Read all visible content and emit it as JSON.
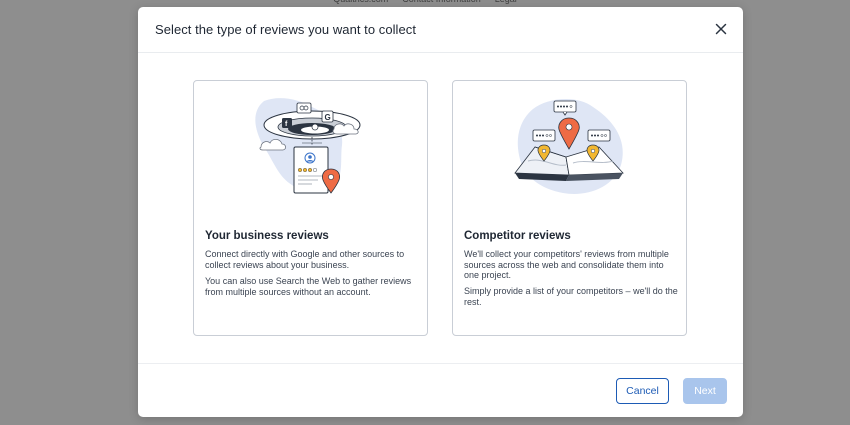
{
  "background": {
    "footer_links": [
      "Qualtrics.com",
      "Contact Information",
      "Legal"
    ]
  },
  "modal": {
    "title": "Select the type of reviews you want to collect",
    "close_icon": "close-icon"
  },
  "cards": [
    {
      "title": "Your business reviews",
      "paragraphs": [
        "Connect directly with Google and other sources to collect reviews about your business.",
        "You can also use Search the Web to gather reviews from multiple sources without an account."
      ],
      "illustration": "business-reviews-illustration"
    },
    {
      "title": "Competitor reviews",
      "paragraphs": [
        "We'll collect your competitors' reviews from multiple sources across the web and consolidate them into one project.",
        "Simply provide a list of your competitors – we'll do the rest."
      ],
      "illustration": "competitor-map-illustration"
    }
  ],
  "footer": {
    "cancel_label": "Cancel",
    "next_label": "Next"
  },
  "colors": {
    "primary": "#1d5bb5",
    "disabled": "#a9c5ec",
    "pin": "#ee6b45",
    "pin_secondary": "#f2b731",
    "accent_blob": "#dfe6f5"
  }
}
